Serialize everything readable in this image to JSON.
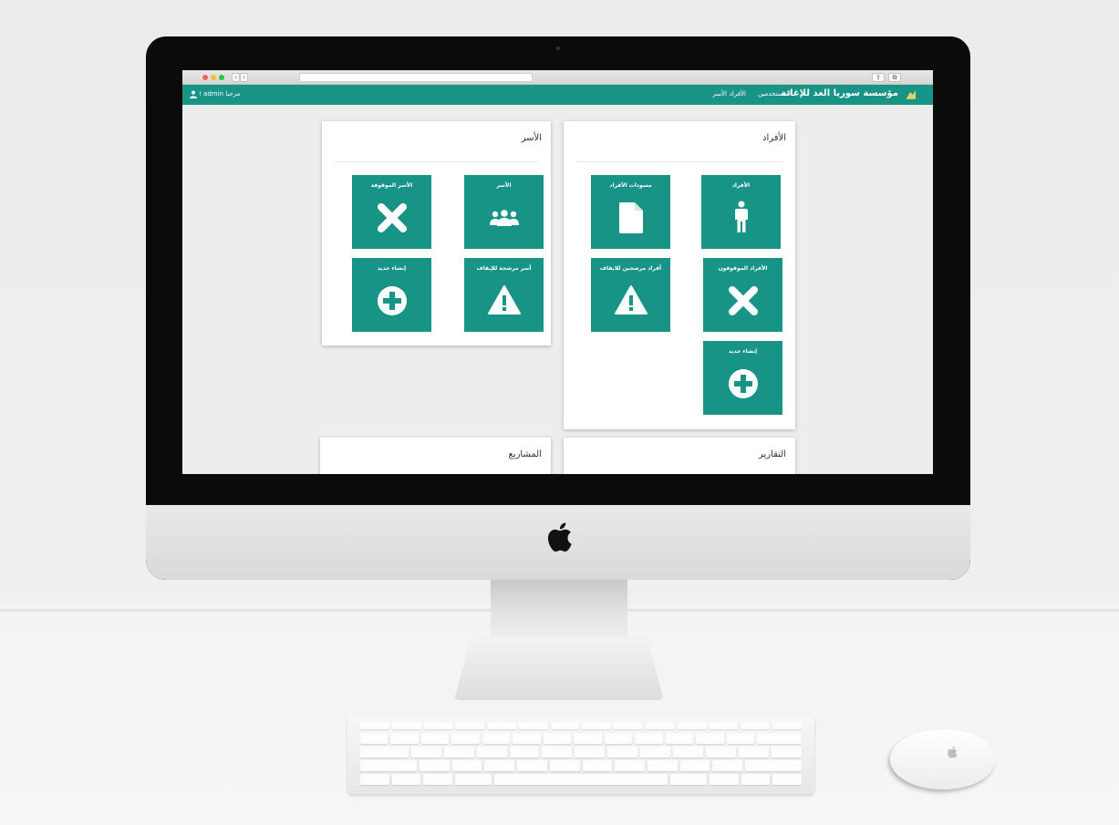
{
  "browser": {
    "back_glyph": "‹",
    "forward_glyph": "›",
    "share_glyph": "⇧",
    "tabs_glyph": "⧉"
  },
  "nav": {
    "brand": "مؤسسة سوريا الغد للإغاثة",
    "links": {
      "users": "المستخدمين",
      "individuals": "الأفراد",
      "families": "الأسر"
    },
    "greeting": "مرحبا admin !"
  },
  "panels": {
    "individuals": {
      "title": "الأفراد",
      "tiles": {
        "individuals": "الأفراد",
        "drafts": "مسودات الأفراد",
        "suspended": "الأفراد الموقوفون",
        "candidates": "أفراد مرشحين للايقاف",
        "create": "إنشاء جديد"
      }
    },
    "families": {
      "title": "الأسر",
      "tiles": {
        "families": "الأسر",
        "suspended": "الأسر الموقوفة",
        "candidates": "أسر مرشحة للإيقاف",
        "create": "إنشاء جديد"
      }
    },
    "reports": {
      "title": "التقارير"
    },
    "projects": {
      "title": "المشاريع"
    }
  },
  "colors": {
    "accent": "#179486",
    "screen_bg": "#ededed"
  },
  "icons": [
    "person-icon",
    "document-icon",
    "close-x-icon",
    "warning-icon",
    "plus-circle-icon",
    "group-icon",
    "user-icon",
    "apple-logo-icon"
  ]
}
